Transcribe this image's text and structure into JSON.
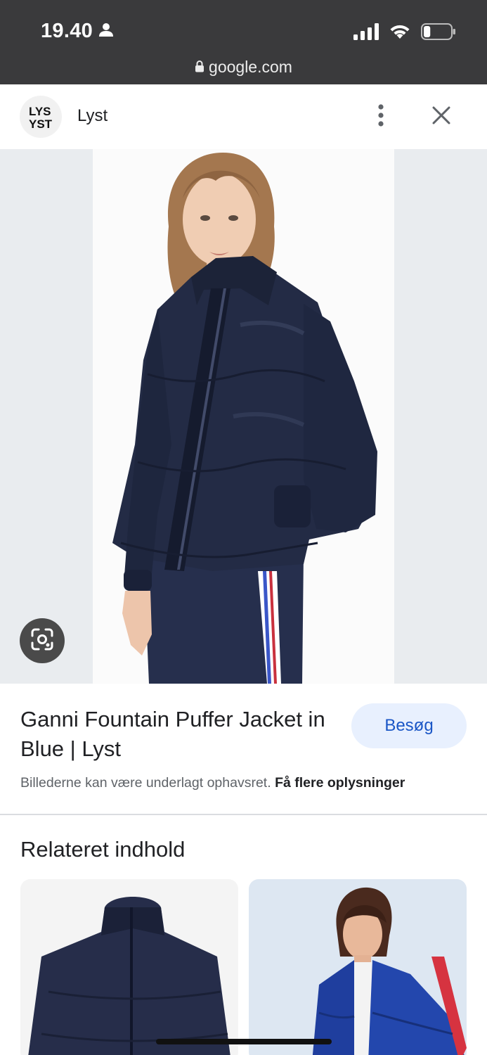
{
  "status_bar": {
    "time": "19.40",
    "person_icon": "person-icon",
    "signal_icon": "cellular-signal-icon",
    "wifi_icon": "wifi-icon",
    "battery_icon": "battery-icon",
    "battery_level": 0.25
  },
  "browser": {
    "url": "google.com",
    "lock_icon": "lock-icon"
  },
  "header": {
    "site_name": "Lyst",
    "more_icon": "more-vert-icon",
    "close_icon": "close-icon"
  },
  "image": {
    "lens_icon": "google-lens-icon"
  },
  "result": {
    "title": "Ganni Fountain Puffer Jacket in Blue | Lyst",
    "visit_label": "Besøg",
    "copyright_text": "Billederne kan være underlagt ophavsret.",
    "more_info_link": "Få flere oplysninger"
  },
  "related": {
    "heading": "Relateret indhold"
  },
  "colors": {
    "status_bar_bg": "#3a3a3c",
    "jacket_navy": "#232b45",
    "visit_btn_bg": "#e8f0fe",
    "visit_btn_text": "#1a56c6"
  }
}
